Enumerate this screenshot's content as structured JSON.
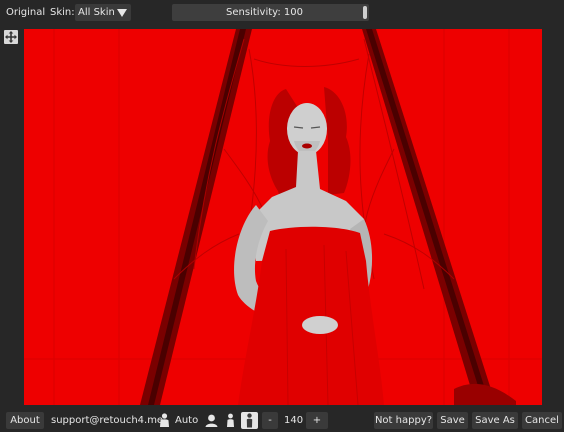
{
  "toolbar": {
    "original_label": "Original",
    "skin_label": "Skin:",
    "skin_value": "All Skin",
    "sensitivity_label": "Sensitivity: 100",
    "sensitivity_level": 100
  },
  "footer": {
    "about_label": "About",
    "support_email": "support@retouch4.me",
    "auto_label": "Auto",
    "minus_label": "-",
    "value": "140",
    "plus_label": "+",
    "not_happy_label": "Not happy?",
    "save_label": "Save",
    "save_as_label": "Save As",
    "cancel_label": "Cancel"
  },
  "colors": {
    "background": "#272727",
    "mask_red": "#ef0000",
    "button": "#3a3a3a",
    "text": "#e6e6e6"
  },
  "icons": [
    "move-icon",
    "person-auto-icon",
    "portrait-icon",
    "person-icon",
    "person-selected-icon"
  ]
}
